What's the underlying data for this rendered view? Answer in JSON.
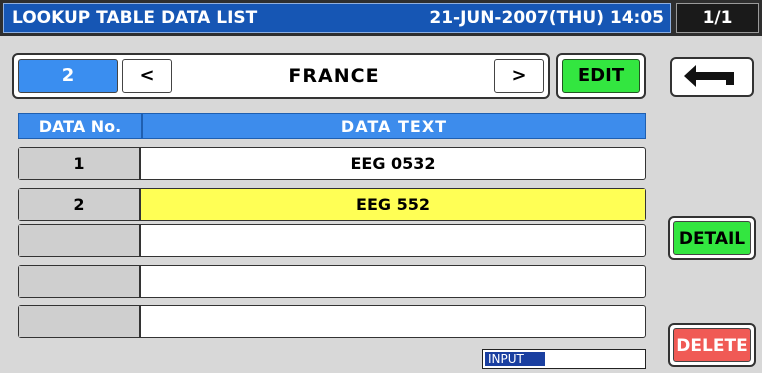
{
  "header": {
    "title": "LOOKUP TABLE DATA LIST",
    "datetime": "21-JUN-2007(THU) 14:05",
    "page": "1/1"
  },
  "nav": {
    "number": "2",
    "prev_label": "<",
    "name": "FRANCE",
    "next_label": ">",
    "edit_label": "EDIT"
  },
  "table": {
    "headers": [
      "DATA No.",
      "DATA TEXT"
    ],
    "rows": [
      {
        "no": "1",
        "text": "EEG 0532"
      },
      {
        "no": "2",
        "text": "EEG 552"
      },
      {
        "no": "",
        "text": ""
      },
      {
        "no": "",
        "text": ""
      },
      {
        "no": "",
        "text": ""
      }
    ],
    "selected_row": 2
  },
  "side": {
    "back_icon": "return-arrow-icon",
    "detail_label": "DETAIL",
    "delete_label": "DELETE"
  },
  "status": {
    "input_label": "INPUT"
  },
  "colors": {
    "title_blue": "#1656b4",
    "header_blue": "#3d8cec",
    "green": "#33e640",
    "red": "#f05a55",
    "selected_yellow": "#ffff55"
  }
}
